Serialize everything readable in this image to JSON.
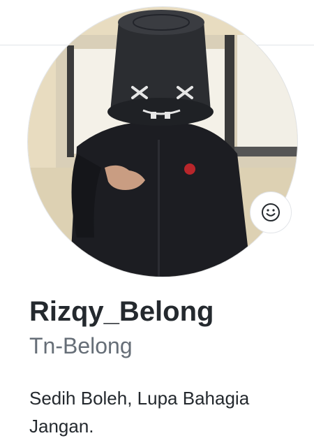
{
  "profile": {
    "name": "Rizqy_Belong",
    "username": "Tn-Belong",
    "bio": "Sedih Boleh, Lupa Bahagia Jangan."
  },
  "avatar": {
    "icon": "user-avatar-photo"
  },
  "status": {
    "icon": "smiley-icon"
  },
  "colors": {
    "text_primary": "#24292e",
    "text_secondary": "#666e77",
    "border": "#e1e4e8",
    "background": "#ffffff"
  }
}
